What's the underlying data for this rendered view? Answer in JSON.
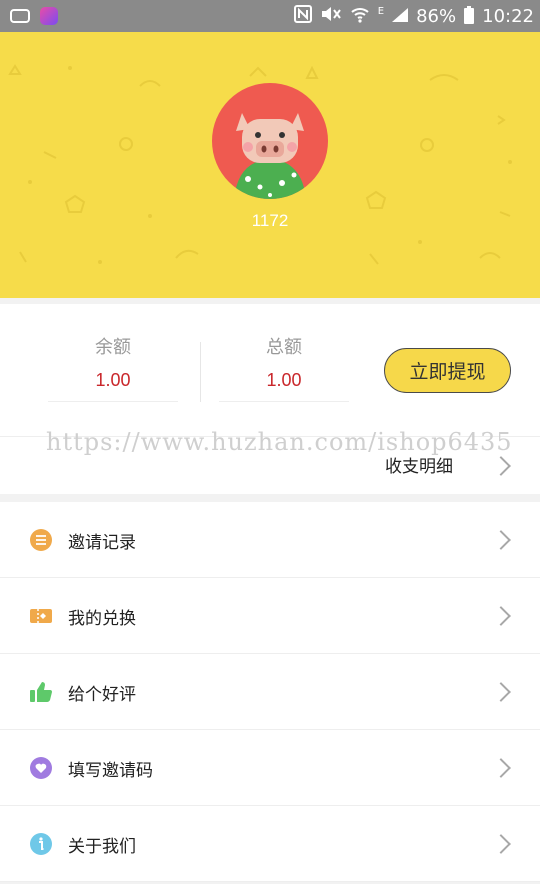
{
  "status_bar": {
    "battery": "86%",
    "time": "10:22",
    "network_type": "E",
    "icons": [
      "message-icon",
      "app-icon",
      "nfc-icon",
      "mute-icon",
      "wifi-icon",
      "signal-icon",
      "battery-icon"
    ]
  },
  "profile": {
    "user_id": "1172",
    "avatar": "pig-avatar",
    "header_color": "#f6dc4a"
  },
  "balance": {
    "balance_label": "余额",
    "balance_value": "1.00",
    "total_label": "总额",
    "total_value": "1.00",
    "withdraw_button": "立即提现",
    "detail_label": "收支明细",
    "watermark": "https://www.huzhan.com/ishop6435",
    "value_color": "#c9272b"
  },
  "menu": {
    "items": [
      {
        "label": "邀请记录",
        "icon": "list-icon",
        "color": "#f0a94a"
      },
      {
        "label": "我的兑换",
        "icon": "ticket-icon",
        "color": "#f0a94a"
      },
      {
        "label": "给个好评",
        "icon": "thumbs-up-icon",
        "color": "#5ec96a"
      },
      {
        "label": "填写邀请码",
        "icon": "heart-icon",
        "color": "#a07be0"
      },
      {
        "label": "关于我们",
        "icon": "info-icon",
        "color": "#6fc8e8"
      }
    ]
  }
}
